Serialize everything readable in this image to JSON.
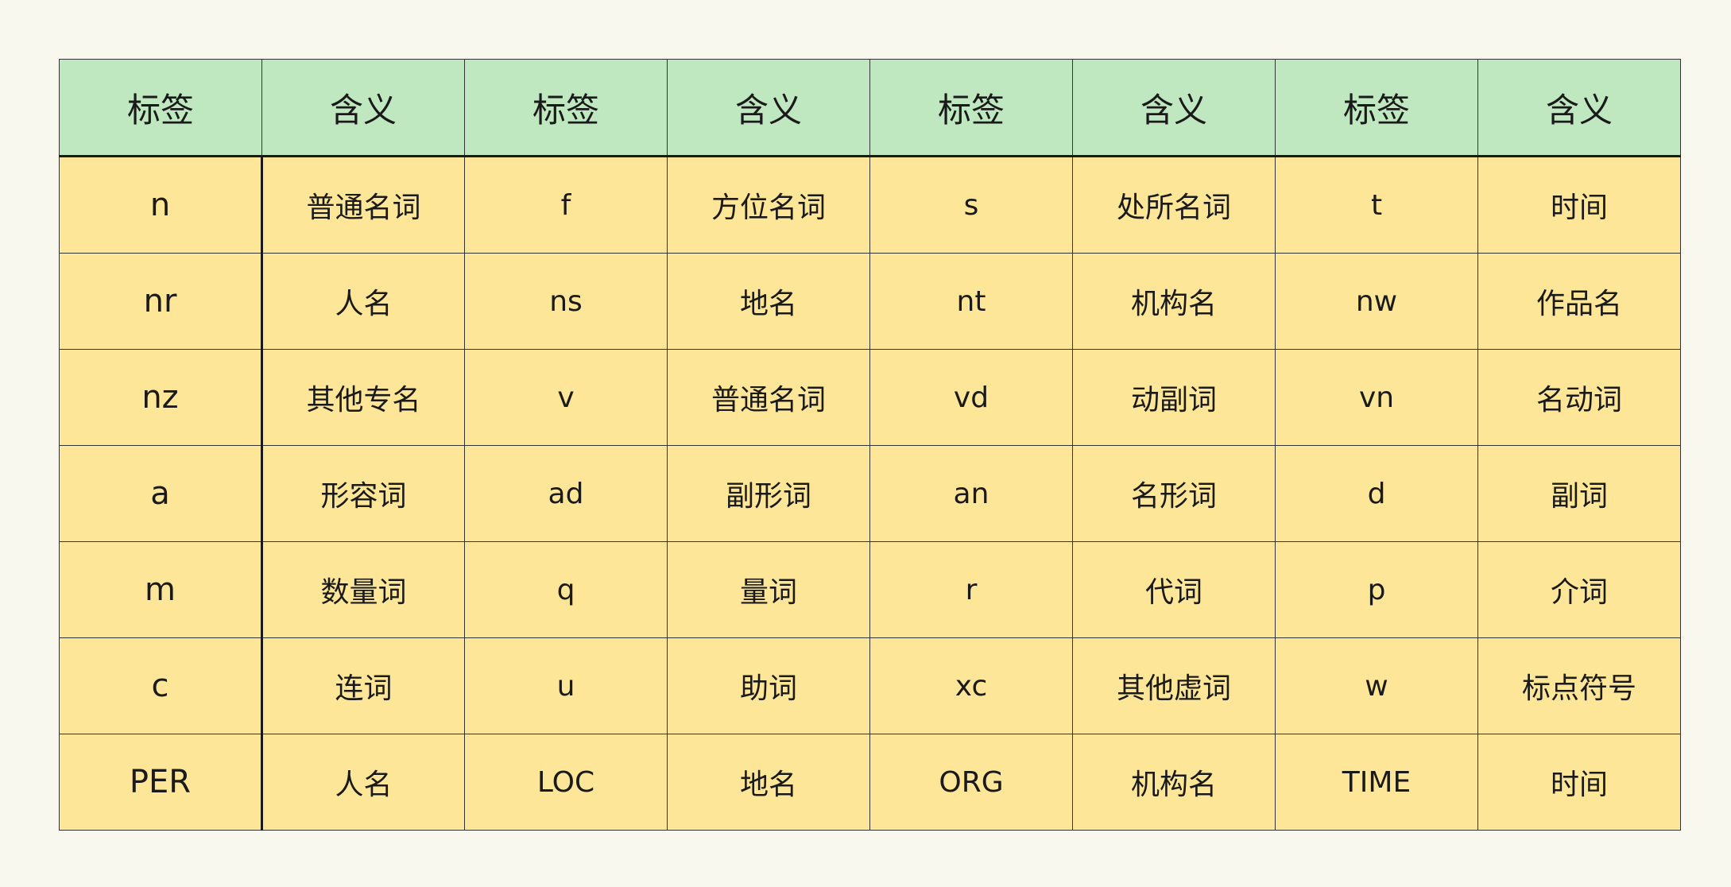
{
  "table": {
    "headers": [
      "标签",
      "含义",
      "标签",
      "含义",
      "标签",
      "含义",
      "标签",
      "含义"
    ],
    "rows": [
      [
        "n",
        "普通名词",
        "f",
        "方位名词",
        "s",
        "处所名词",
        "t",
        "时间"
      ],
      [
        "nr",
        "人名",
        "ns",
        "地名",
        "nt",
        "机构名",
        "nw",
        "作品名"
      ],
      [
        "nz",
        "其他专名",
        "v",
        "普通名词",
        "vd",
        "动副词",
        "vn",
        "名动词"
      ],
      [
        "a",
        "形容词",
        "ad",
        "副形词",
        "an",
        "名形词",
        "d",
        "副词"
      ],
      [
        "m",
        "数量词",
        "q",
        "量词",
        "r",
        "代词",
        "p",
        "介词"
      ],
      [
        "c",
        "连词",
        "u",
        "助词",
        "xc",
        "其他虚词",
        "w",
        "标点符号"
      ],
      [
        "PER",
        "人名",
        "LOC",
        "地名",
        "ORG",
        "机构名",
        "TIME",
        "时间"
      ]
    ]
  },
  "colors": {
    "page_background": "#f8f8ee",
    "header_background": "#c0e8c0",
    "cell_background": "#fde697",
    "border": "#333333"
  }
}
